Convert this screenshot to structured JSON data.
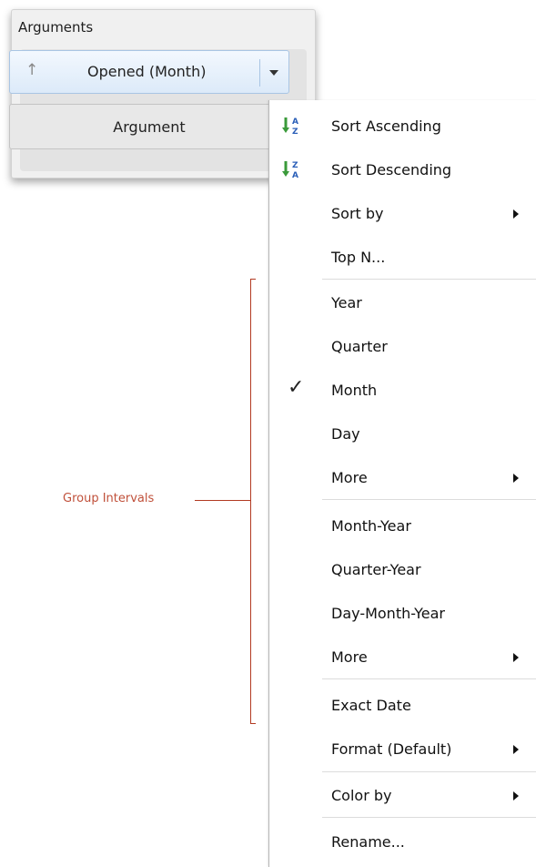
{
  "panel": {
    "title": "Arguments",
    "argument_button": {
      "label": "Opened (Month)",
      "sort_icon": "↑"
    },
    "placeholder_label": "Argument"
  },
  "menu": {
    "sort_ascending": "Sort Ascending",
    "sort_descending": "Sort Descending",
    "sort_by": "Sort by",
    "top_n": "Top N...",
    "year": "Year",
    "quarter": "Quarter",
    "month": "Month",
    "day": "Day",
    "more_1": "More",
    "month_year": "Month-Year",
    "quarter_year": "Quarter-Year",
    "day_month_year": "Day-Month-Year",
    "more_2": "More",
    "exact_date": "Exact Date",
    "format": "Format (Default)",
    "color_by": "Color by",
    "rename": "Rename...",
    "check_glyph": "✓"
  },
  "annotation": {
    "label": "Group Intervals",
    "color": "#c0503a"
  },
  "colors": {
    "accent_green": "#3a9a3a",
    "accent_blue": "#2b5fb8",
    "selected_border": "#a9c5e4"
  }
}
